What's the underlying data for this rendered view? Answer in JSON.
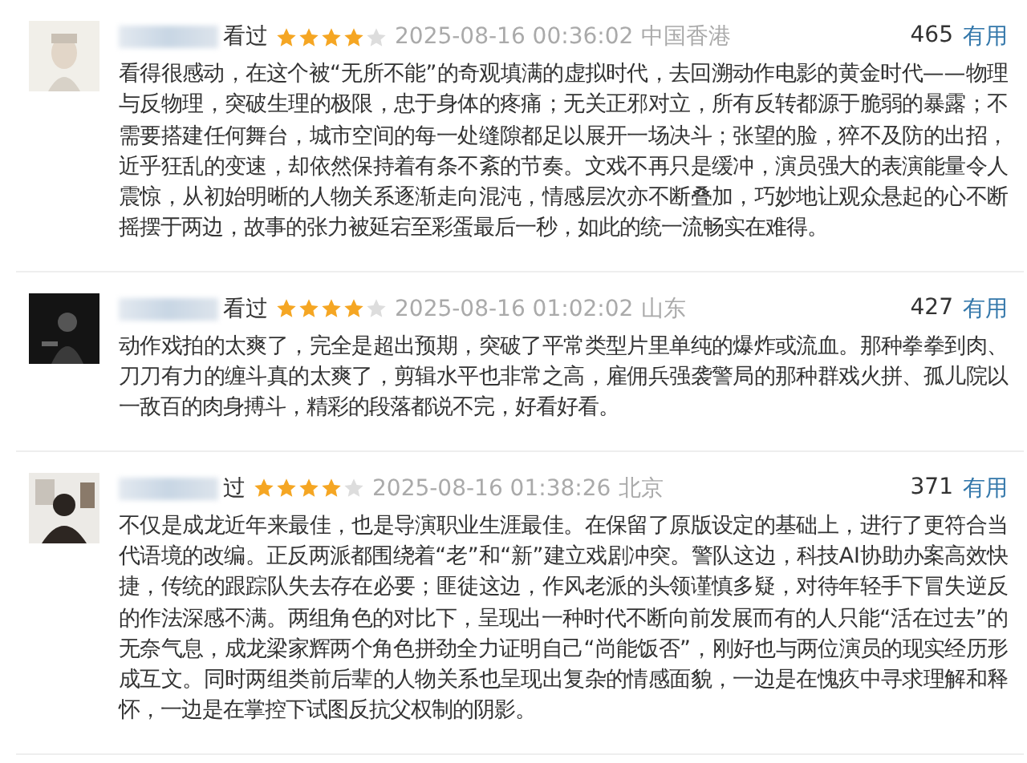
{
  "reviews": [
    {
      "status": "看过",
      "stars": 4,
      "time": "2025-08-16 00:36:02",
      "location": "中国香港",
      "votes": "465",
      "vote_label": "有用",
      "text": "看得很感动，在这个被“无所不能”的奇观填满的虚拟时代，去回溯动作电影的黄金时代——物理与反物理，突破生理的极限，忠于身体的疼痛；无关正邪对立，所有反转都源于脆弱的暴露；不需要搭建任何舞台，城市空间的每一处缝隙都足以展开一场决斗；张望的脸，猝不及防的出招，近乎狂乱的变速，却依然保持着有条不紊的节奏。文戏不再只是缓冲，演员强大的表演能量令人震惊，从初始明晰的人物关系逐渐走向混沌，情感层次亦不断叠加，巧妙地让观众悬起的心不断摇摆于两边，故事的张力被延宕至彩蛋最后一秒，如此的统一流畅实在难得。"
    },
    {
      "status": "看过",
      "stars": 4,
      "time": "2025-08-16 01:02:02",
      "location": "山东",
      "votes": "427",
      "vote_label": "有用",
      "text": "动作戏拍的太爽了，完全是超出预期，突破了平常类型片里单纯的爆炸或流血。那种拳拳到肉、刀刀有力的缠斗真的太爽了，剪辑水平也非常之高，雇佣兵强袭警局的那种群戏火拼、孤儿院以一敌百的肉身搏斗，精彩的段落都说不完，好看好看。"
    },
    {
      "status": "过",
      "stars": 4,
      "time": "2025-08-16 01:38:26",
      "location": "北京",
      "votes": "371",
      "vote_label": "有用",
      "text": "不仅是成龙近年来最佳，也是导演职业生涯最佳。在保留了原版设定的基础上，进行了更符合当代语境的改编。正反两派都围绕着“老”和“新”建立戏剧冲突。警队这边，科技AI协助办案高效快捷，传统的跟踪队失去存在必要；匪徒这边，作风老派的头领谨慎多疑，对待年轻手下冒失逆反的作法深感不满。两组角色的对比下，呈现出一种时代不断向前发展而有的人只能“活在过去”的无奈气息，成龙梁家辉两个角色拼劲全力证明自己“尚能饭否”，刚好也与两位演员的现实经历形成互文。同时两组类前后辈的人物关系也呈现出复杂的情感面貌，一边是在愧疚中寻求理解和释怀，一边是在掌控下试图反抗父权制的阴影。"
    }
  ]
}
